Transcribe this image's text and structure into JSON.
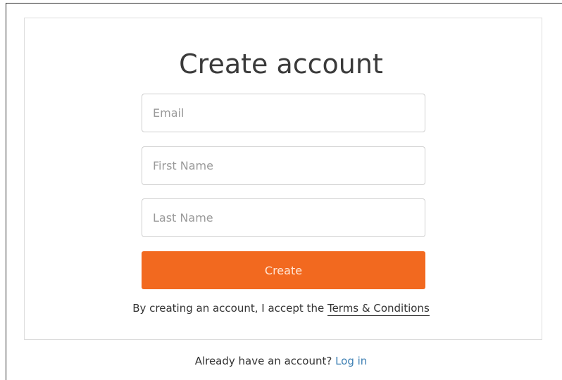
{
  "form": {
    "title": "Create account",
    "email_placeholder": "Email",
    "first_name_placeholder": "First Name",
    "last_name_placeholder": "Last Name",
    "create_label": "Create",
    "terms_prefix": "By creating an account, I accept the ",
    "terms_link": "Terms & Conditions"
  },
  "footer": {
    "login_prompt": "Already have an account? ",
    "login_link": "Log in"
  },
  "colors": {
    "accent": "#f2691f",
    "link": "#3d7fb3"
  }
}
